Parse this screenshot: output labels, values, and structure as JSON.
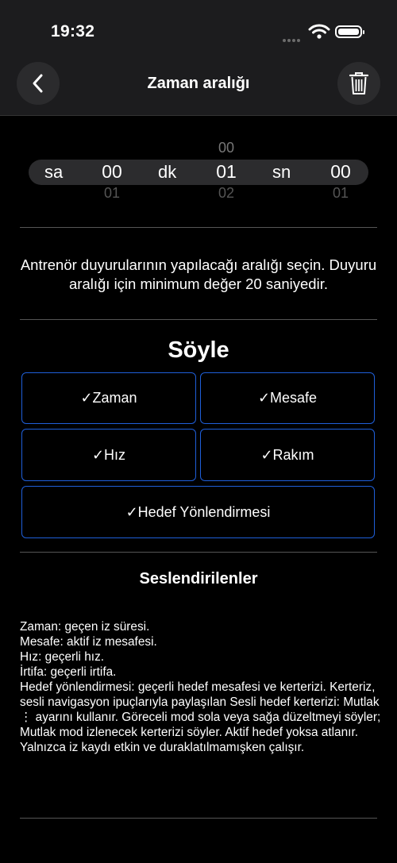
{
  "status_bar": {
    "time": "19:32"
  },
  "nav": {
    "title": "Zaman aralığı",
    "back_icon": "chevron-left-icon",
    "trash_icon": "trash-icon"
  },
  "picker": {
    "hours_label": "sa",
    "minutes_label": "dk",
    "seconds_label": "sn",
    "hours": {
      "prev": "",
      "current": "00",
      "next": "01"
    },
    "minutes": {
      "prev": "00",
      "current": "01",
      "next": "02"
    },
    "seconds": {
      "prev": "",
      "current": "00",
      "next": "01"
    }
  },
  "description": "Antrenör duyurularının yapılacağı aralığı seçin. Duyuru aralığı için minimum değer 20 saniyedir.",
  "say_section": {
    "title": "Söyle",
    "options": {
      "time": "✓Zaman",
      "distance": "✓Mesafe",
      "speed": "✓Hız",
      "altitude": "✓Rakım",
      "target_direction": "✓Hedef Yönlendirmesi"
    },
    "accent_color": "#1f5fd9"
  },
  "spoken": {
    "title": "Seslendirilenler",
    "text": "Zaman: geçen iz süresi.\nMesafe: aktif iz mesafesi.\nHız: geçerli hız.\nİrtifa: geçerli irtifa.\nHedef yönlendirmesi: geçerli hedef mesafesi ve kerterizi. Kerteriz, sesli navigasyon ipuçlarıyla paylaşılan Sesli hedef kerterizi: Mutlak ⋮ ayarını kullanır. Göreceli mod sola veya sağa düzeltmeyi söyler; Mutlak mod izlenecek kerterizi söyler. Aktif hedef yoksa atlanır. Yalnızca iz kaydı etkin ve duraklatılmamışken çalışır."
  }
}
